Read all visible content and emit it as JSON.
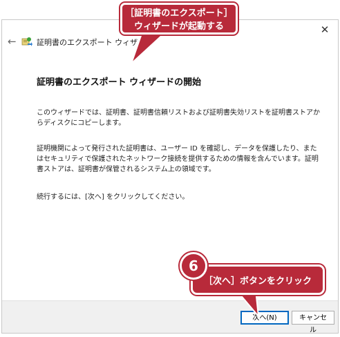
{
  "wizard": {
    "title": "証明書のエクスポート ウィザード",
    "heading": "証明書のエクスポート ウィザードの開始",
    "paragraph1": "このウィザードでは、証明書、証明書信頼リストおよび証明書失効リストを証明書ストアからディスクにコピーします。",
    "paragraph2": "証明機関によって発行された証明書は、ユーザー ID を確認し、データを保護したり、またはセキュリティで保護されたネットワーク接続を提供するための情報を含んでいます。証明書ストアは、証明書が保管されるシステム上の領域です。",
    "paragraph3": "続行するには、[次へ] をクリックしてください。",
    "close_glyph": "✕",
    "back_glyph": "←"
  },
  "buttons": {
    "next_label": "次へ(N)",
    "cancel_label": "キャンセル"
  },
  "annotations": {
    "top_callout_line1": "［証明書のエクスポート］",
    "top_callout_line2": "ウィザードが起動する",
    "step_number": "6",
    "bottom_callout": "［次へ］ボタンをクリック",
    "callout_color": "#b82a3a"
  }
}
